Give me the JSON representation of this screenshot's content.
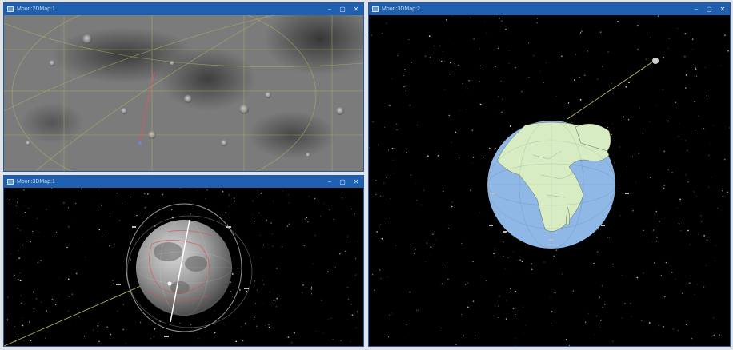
{
  "windows": {
    "top_left": {
      "title": "Moon:2DMap:1",
      "controls": {
        "minimize": "–",
        "maximize": "▢",
        "close": "✕"
      }
    },
    "bottom_left": {
      "title": "Moon:3DMap:1",
      "controls": {
        "minimize": "–",
        "maximize": "▢",
        "close": "✕"
      }
    },
    "right": {
      "title": "Moon:3DMap:2",
      "controls": {
        "minimize": "–",
        "maximize": "▢",
        "close": "✕"
      }
    }
  },
  "icons": {
    "window_icon": "window-app-icon",
    "minimize": "minimize-icon",
    "maximize": "maximize-icon",
    "close": "close-icon"
  },
  "colors": {
    "titlebar": "#1f5fb0",
    "space": "#000000",
    "earth_ocean": "#8fb8e6",
    "earth_land": "#d7ecc3",
    "grid": "#b9b565",
    "orbit": "#c9c9c9",
    "moon_boundary": "#d85050"
  }
}
